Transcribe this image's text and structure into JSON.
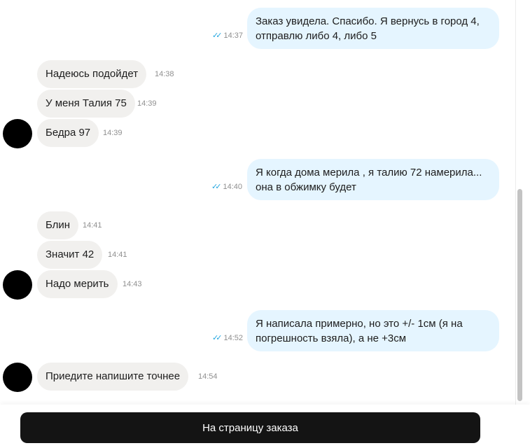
{
  "messages": [
    {
      "dir": "out",
      "text": "Заказ увидела. Спасибо. Я вернусь в город 4, отправлю либо 4, либо 5",
      "time": "14:37",
      "status_icon": "double-check-icon"
    },
    {
      "dir": "in",
      "text": "Надеюсь подойдет",
      "time": "14:38"
    },
    {
      "dir": "in",
      "text": "У меня Талия 75",
      "time": "14:39"
    },
    {
      "dir": "in",
      "text": "Бедра 97",
      "time": "14:39"
    },
    {
      "dir": "out",
      "text": "Я когда дома мерила , я талию 72 намерила... она в обжимку будет",
      "time": "14:40",
      "status_icon": "double-check-icon"
    },
    {
      "dir": "in",
      "text": "Блин",
      "time": "14:41"
    },
    {
      "dir": "in",
      "text": "Значит 42",
      "time": "14:41"
    },
    {
      "dir": "in",
      "text": "Надо мерить",
      "time": "14:43"
    },
    {
      "dir": "out",
      "text": "Я написала примерно, но это +/- 1см (я на погрешность взяла), а не +3см",
      "time": "14:52",
      "status_icon": "double-check-icon"
    },
    {
      "dir": "in",
      "text": "Приедите напишите точнее",
      "time": "14:54"
    }
  ],
  "footer": {
    "order_button_label": "На страницу заказа"
  },
  "colors": {
    "incoming_bubble": "#f1f0ee",
    "outgoing_bubble": "#e5f5ff",
    "read_check": "#22a6e0",
    "avatar": "#000000",
    "button_bg": "#141414"
  }
}
